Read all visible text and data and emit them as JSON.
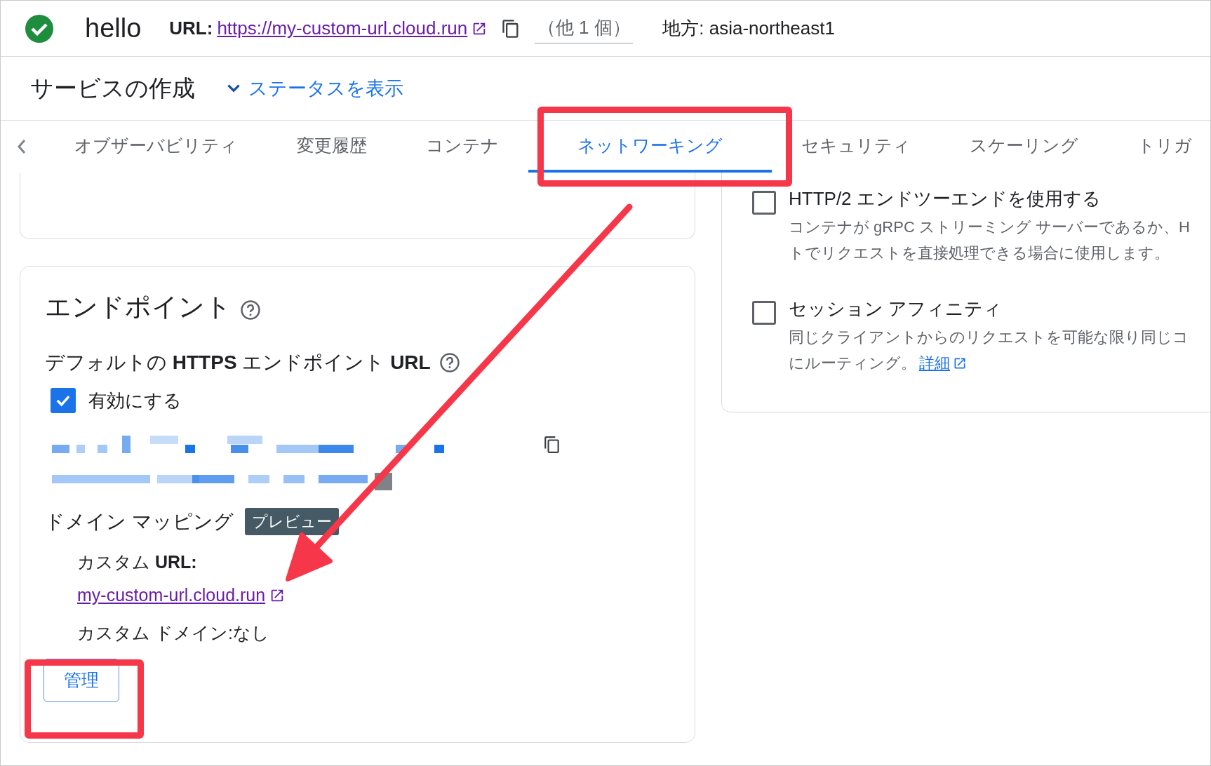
{
  "header": {
    "service_name": "hello",
    "url_label": "URL:",
    "url": "https://my-custom-url.cloud.run",
    "other_count": "（他 1 個）",
    "region": "地方: asia-northeast1"
  },
  "subheader": {
    "title": "サービスの作成",
    "status_link": "ステータスを表示"
  },
  "tabs": [
    {
      "label": "オブザーバビリティ",
      "selected": false
    },
    {
      "label": "変更履歴",
      "selected": false
    },
    {
      "label": "コンテナ",
      "selected": false
    },
    {
      "label": "ネットワーキング",
      "selected": true
    },
    {
      "label": "セキュリティ",
      "selected": false
    },
    {
      "label": "スケーリング",
      "selected": false
    },
    {
      "label": "トリガ",
      "selected": false
    }
  ],
  "networking_options": [
    {
      "label": "HTTP/2 エンドツーエンドを使用する",
      "checked": false,
      "description_lines": [
        "コンテナが gRPC ストリーミング サーバーであるか、H",
        "トでリクエストを直接処理できる場合に使用します。"
      ]
    },
    {
      "label": "セッション アフィニティ",
      "checked": false,
      "description_lines": [
        "同じクライアントからのリクエストを可能な限り同じコ",
        "にルーティング。"
      ],
      "link": "詳細"
    }
  ],
  "endpoints": {
    "title": "エンドポイント",
    "default_url_heading": "デフォルトの **HTTPS** エンドポイント **URL**",
    "enable": {
      "label": "有効にする",
      "checked": true
    },
    "domain_mapping": {
      "title": "ドメイン マッピング",
      "badge": "プレビュー",
      "custom_url_label": "カスタム **URL:**",
      "custom_url": "my-custom-url.cloud.run",
      "custom_domain": "カスタム ドメイン:なし",
      "manage_button": "管理"
    }
  }
}
